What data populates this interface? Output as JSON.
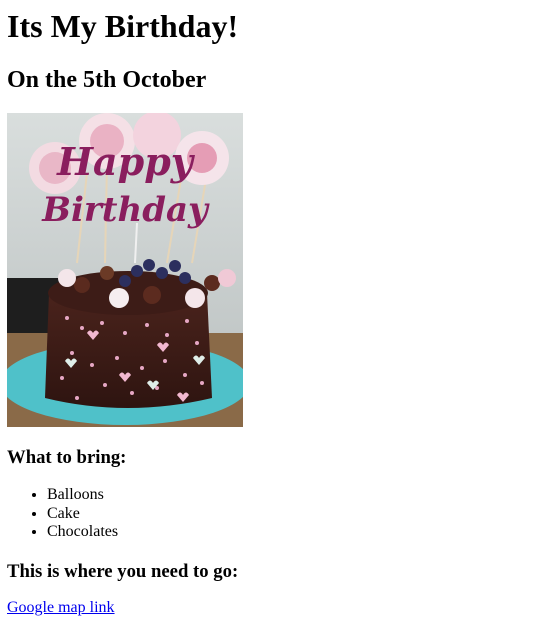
{
  "page": {
    "title": "Its My Birthday!",
    "subtitle": "On the 5th October"
  },
  "image": {
    "topper_text_line1": "Happy",
    "topper_text_line2": "Birthday"
  },
  "bring_section": {
    "heading": "What to bring:",
    "items": [
      "Balloons",
      "Cake",
      "Chocolates"
    ]
  },
  "location_section": {
    "heading": "This is where you need to go:",
    "link_label": "Google map link"
  },
  "colors": {
    "link": "#0000ee",
    "text": "#000000",
    "background": "#ffffff"
  }
}
